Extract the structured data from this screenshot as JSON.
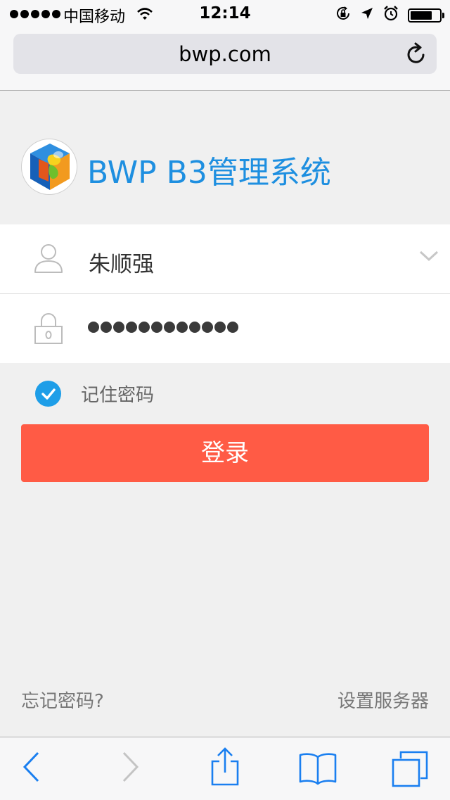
{
  "status_bar": {
    "carrier": "中国移动",
    "time": "12:14",
    "battery_level": 0.75
  },
  "browser": {
    "url": "bwp.com"
  },
  "brand": {
    "title": "BWP B3管理系统"
  },
  "login": {
    "username": "朱顺强",
    "password_dot_count": 12,
    "remember_label": "记住密码",
    "remember_checked": true,
    "submit_label": "登录"
  },
  "footer": {
    "forgot_label": "忘记密码?",
    "server_label": "设置服务器"
  },
  "colors": {
    "accent_blue": "#1e8fe0",
    "login_button": "#ff5b45",
    "page_background": "#f0f0f0"
  }
}
